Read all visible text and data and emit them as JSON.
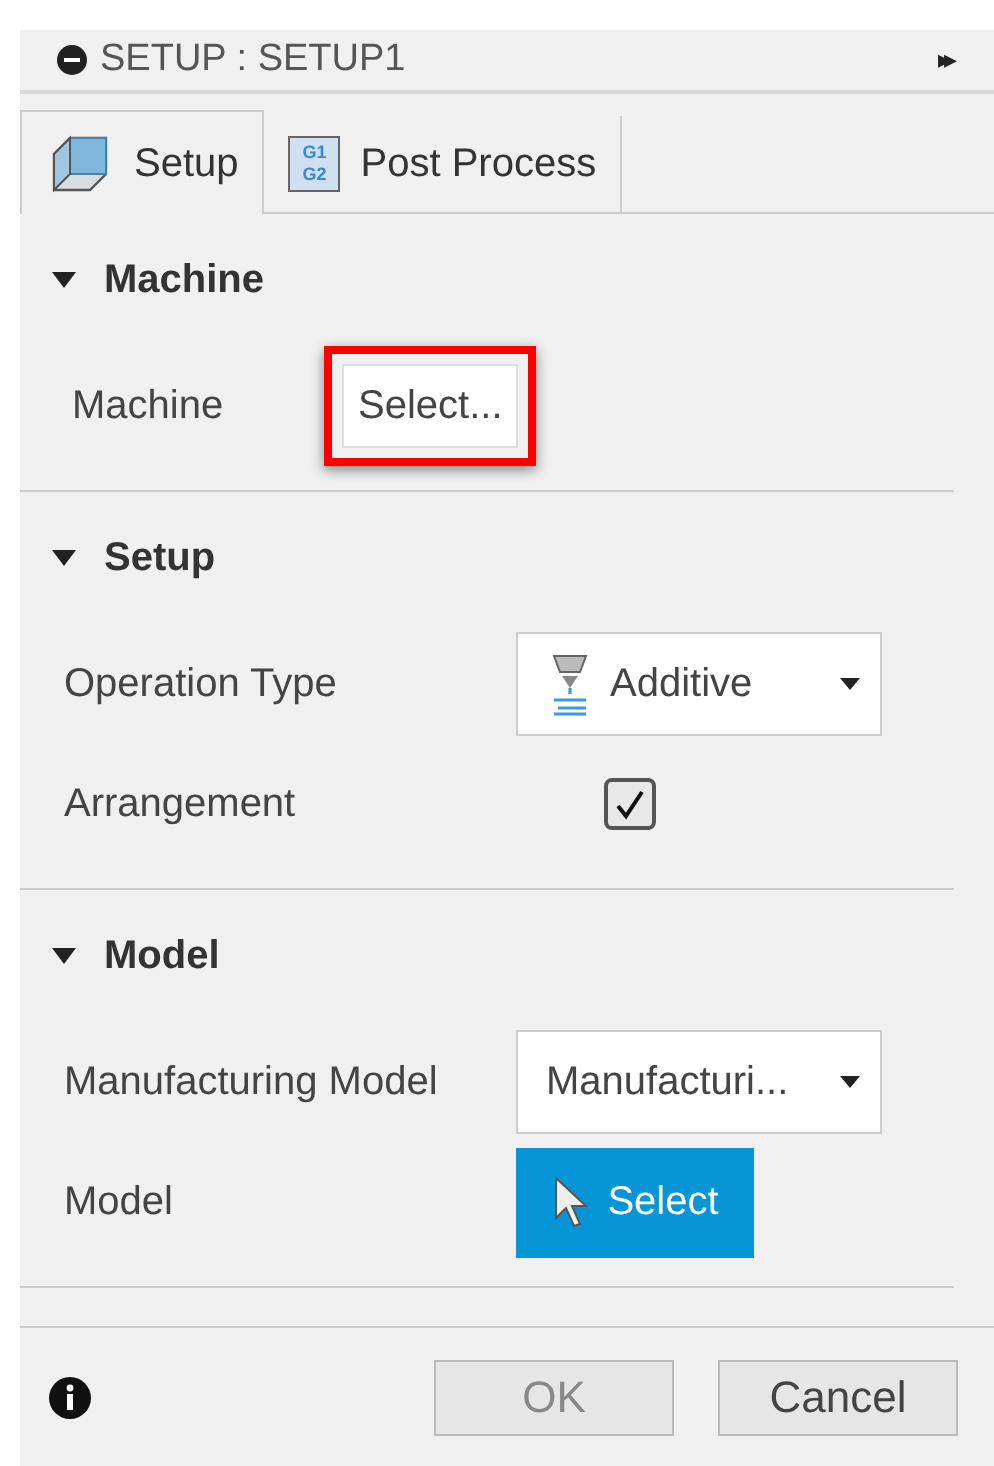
{
  "window": {
    "title": "SETUP : SETUP1",
    "expand_glyph": "▸▸"
  },
  "tabs": [
    {
      "label": "Setup",
      "selected": true,
      "kind": "setup"
    },
    {
      "label": "Post Process",
      "selected": false,
      "kind": "post",
      "icon_lines": [
        "G1",
        "G2"
      ]
    }
  ],
  "sections": [
    {
      "title": "Machine",
      "expanded": true,
      "fields": [
        {
          "kind": "select_button",
          "label": "Machine",
          "value": "Select...",
          "highlighted": true
        }
      ]
    },
    {
      "title": "Setup",
      "expanded": true,
      "fields": [
        {
          "kind": "dropdown",
          "label": "Operation Type",
          "value": "Additive",
          "icon": true
        },
        {
          "kind": "checkbox",
          "label": "Arrangement",
          "checked": true
        }
      ]
    },
    {
      "title": "Model",
      "expanded": true,
      "fields": [
        {
          "kind": "dropdown",
          "label": "Manufacturing Model",
          "value": "Manufacturi...",
          "icon": false
        },
        {
          "kind": "pick_button",
          "label": "Model",
          "value": "Select"
        }
      ]
    }
  ],
  "buttons": [
    {
      "label": "OK",
      "disabled": true
    },
    {
      "label": "Cancel",
      "disabled": false
    }
  ]
}
